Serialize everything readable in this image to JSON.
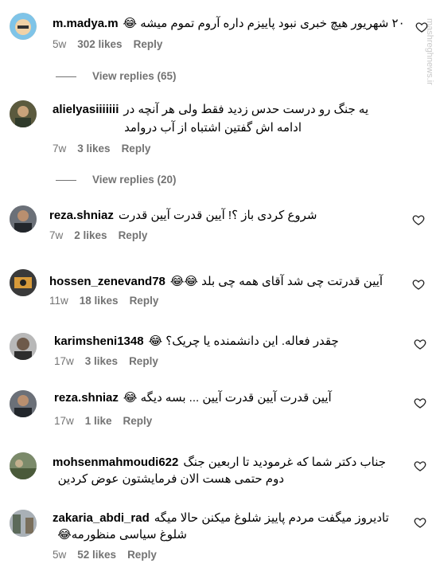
{
  "watermark": "mashreghnews.ir",
  "comments": [
    {
      "username": "m.madya.m",
      "text": "۲۰ شهریور هیچ خبری نبود پاییزم داره آروم تموم میشه 😂",
      "text2": "",
      "time": "5w",
      "likes": "302 likes",
      "reply": "Reply"
    },
    {
      "username": "alielyasiiiiiii",
      "text": "یه جنگ رو درست حدس زدید فقط ولی هر آنچه در",
      "text2": "ادامه اش گفتین اشتباه از آب دروامد",
      "time": "7w",
      "likes": "3 likes",
      "reply": "Reply"
    },
    {
      "username": "reza.shniaz",
      "text": "شروع کردی باز ؟! آیین قدرت آیین قدرت",
      "text2": "",
      "time": "7w",
      "likes": "2 likes",
      "reply": "Reply"
    },
    {
      "username": "hossen_zenevand78",
      "text": "آیین قدرتت چی شد آقای همه چی بلد 😂😂",
      "text2": "",
      "time": "11w",
      "likes": "18 likes",
      "reply": "Reply"
    },
    {
      "username": "karimsheni1348",
      "text": "چقدر فعاله. این دانشمنده یا چریک؟ 😂",
      "text2": "",
      "time": "17w",
      "likes": "3 likes",
      "reply": "Reply"
    },
    {
      "username": "reza.shniaz",
      "text": "آیین قدرت آیین قدرت آیین ... بسه دیگه 😂",
      "text2": "",
      "time": "17w",
      "likes": "1 like",
      "reply": "Reply"
    },
    {
      "username": "mohsenmahmoudi622",
      "text": "جناب دکتر شما که غرمودید تا اربعین جنگ",
      "text2": "دوم حتمی هست الان فرمایشتون عوض کردین",
      "time": "",
      "likes": "",
      "reply": ""
    },
    {
      "username": "zakaria_abdi_rad",
      "text": "تادیروز میگفت مردم پاییز شلوغ میکنن حالا میگه",
      "text2": "شلوغ سیاسی منظورمه😂",
      "time": "5w",
      "likes": "52 likes",
      "reply": "Reply"
    }
  ],
  "view_replies": [
    "View replies (65)",
    "View replies (20)"
  ],
  "icons": {
    "like": "heart-outline-icon"
  }
}
